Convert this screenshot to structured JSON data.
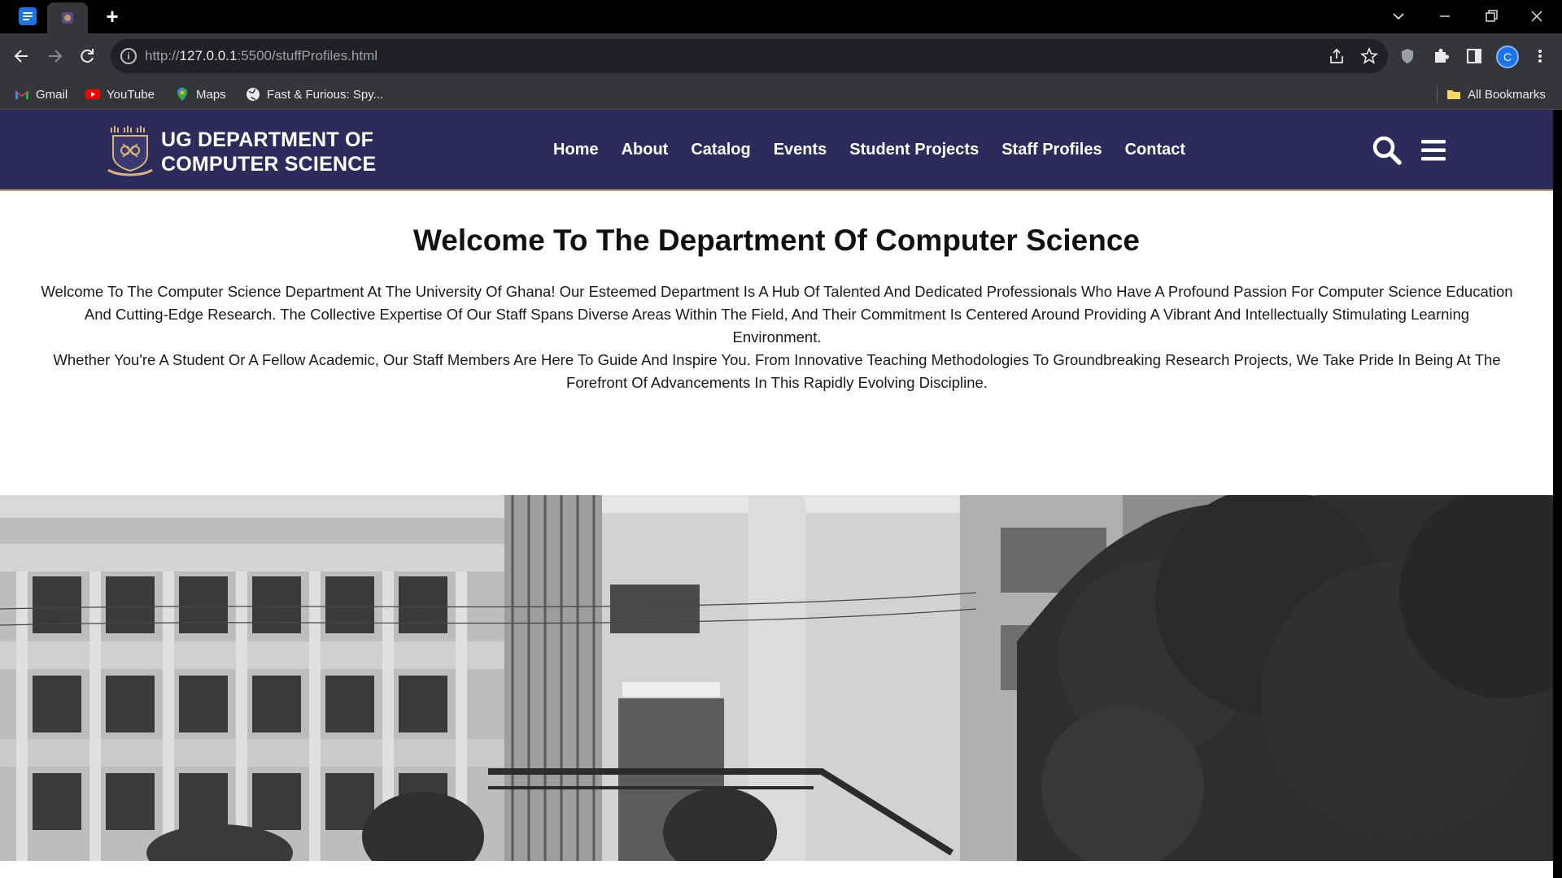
{
  "browser": {
    "new_tab_symbol": "+",
    "url_prefix": "http://",
    "url_host": "127.0.0.1",
    "url_rest": ":5500/stuffProfiles.html",
    "profile_initial": "C",
    "bookmarks": [
      {
        "label": "Gmail",
        "icon": "gmail-icon"
      },
      {
        "label": "YouTube",
        "icon": "youtube-icon"
      },
      {
        "label": "Maps",
        "icon": "maps-icon"
      },
      {
        "label": "Fast & Furious: Spy...",
        "icon": "globe-icon"
      }
    ],
    "all_bookmarks": "All Bookmarks"
  },
  "site": {
    "brand_line1": "UG DEPARTMENT OF",
    "brand_line2": "COMPUTER SCIENCE",
    "nav": [
      "Home",
      "About",
      "Catalog",
      "Events",
      "Student Projects",
      "Staff Profiles",
      "Contact"
    ],
    "colors": {
      "header_bg": "#2d2a5c",
      "header_accent": "#c59a62"
    }
  },
  "main": {
    "title": "Welcome To The Department Of Computer Science",
    "paragraph1": "Welcome To The Computer Science Department At The University Of Ghana! Our Esteemed Department Is A Hub Of Talented And Dedicated Professionals Who Have A Profound Passion For Computer Science Education And Cutting-Edge Research. The Collective Expertise Of Our Staff Spans Diverse Areas Within The Field, And Their Commitment Is Centered Around Providing A Vibrant And Intellectually Stimulating Learning Environment.",
    "paragraph2": "Whether You're A Student Or A Fellow Academic, Our Staff Members Are Here To Guide And Inspire You. From Innovative Teaching Methodologies To Groundbreaking Research Projects, We Take Pride In Being At The Forefront Of Advancements In This Rapidly Evolving Discipline."
  }
}
